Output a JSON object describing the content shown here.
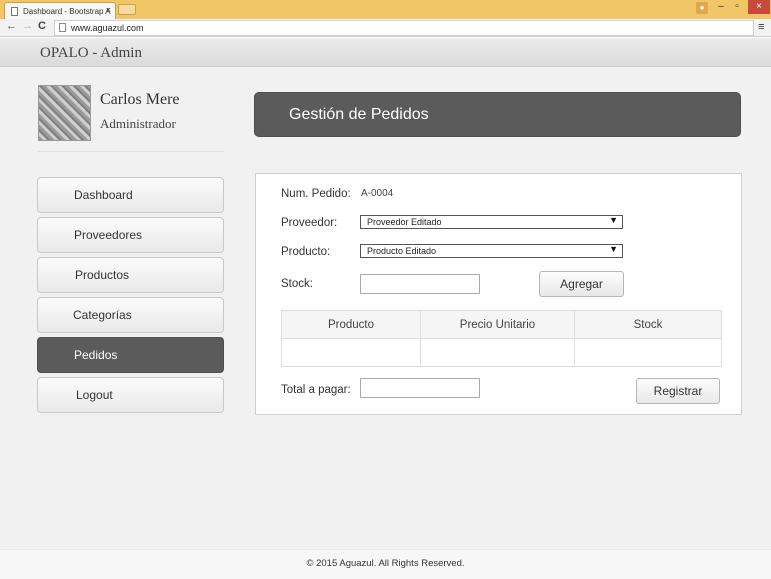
{
  "browser": {
    "tab_title": "Dashboard - Bootstrap A",
    "tab_close": "×",
    "url": "www.aguazul.com",
    "controls": {
      "back": "←",
      "forward": "→",
      "reload": "C",
      "menu": "≡",
      "minimize": "–",
      "maximize": "▫",
      "close": "×"
    }
  },
  "app": {
    "brand": "OPALO - Admin"
  },
  "user": {
    "name": "Carlos Mere",
    "role": "Administrador"
  },
  "sidebar": {
    "items": [
      {
        "label": "Dashboard",
        "active": false
      },
      {
        "label": "Proveedores",
        "active": false
      },
      {
        "label": "Productos",
        "active": false
      },
      {
        "label": "Categorías",
        "active": false
      },
      {
        "label": "Pedidos",
        "active": true
      },
      {
        "label": "Logout",
        "active": false
      }
    ]
  },
  "panel": {
    "title": "Gestión de Pedidos"
  },
  "form": {
    "num_pedido_label": "Num. Pedido:",
    "num_pedido_value": "A-0004",
    "proveedor_label": "Proveedor:",
    "proveedor_value": "Proveedor Editado",
    "producto_label": "Producto:",
    "producto_value": "Producto Editado",
    "stock_label": "Stock:",
    "stock_value": "",
    "agregar_label": "Agregar",
    "total_label": "Total a pagar:",
    "total_value": "",
    "registrar_label": "Registrar",
    "select_arrow": "▼"
  },
  "table": {
    "headers": [
      "Producto",
      "Precio Unitario",
      "Stock"
    ],
    "rows": [
      [
        "",
        "",
        ""
      ]
    ]
  },
  "footer": {
    "text": "© 2015 Aguazul. All Rights Reserved."
  },
  "colors": {
    "chrome": "#f0c666",
    "active_item": "#5b5b5b",
    "header_panel": "#5b5b5b"
  }
}
